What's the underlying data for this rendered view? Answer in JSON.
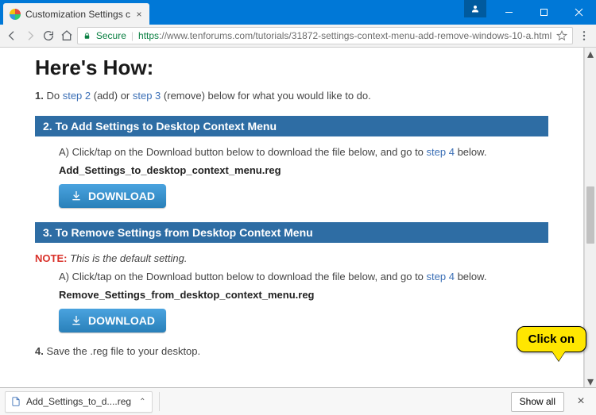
{
  "window": {
    "tab_title": "Customization Settings c",
    "user_icon": "user-icon"
  },
  "toolbar": {
    "secure_label": "Secure",
    "url_protocol": "https",
    "url_rest": "://www.tenforums.com/tutorials/31872-settings-context-menu-add-remove-windows-10-a.html"
  },
  "content": {
    "heading": "Here's How:",
    "step1": {
      "num": "1.",
      "pre": "Do ",
      "link_a": "step 2",
      "mid": " (add) or ",
      "link_b": "step 3",
      "post": " (remove) below for what you would like to do."
    },
    "section2": {
      "title": "2. To Add Settings to Desktop Context Menu",
      "lineA": {
        "prefix": "A) Click/tap on the Download button below to download the file below, and go to ",
        "link": "step 4",
        "suffix": " below."
      },
      "filename": "Add_Settings_to_desktop_context_menu.reg",
      "download": "DOWNLOAD"
    },
    "section3": {
      "title": "3. To Remove Settings from Desktop Context Menu",
      "note_label": "NOTE:",
      "note_text": "This is the default setting.",
      "lineA": {
        "prefix": "A) Click/tap on the Download button below to download the file below, and go to ",
        "link": "step 4",
        "suffix": " below."
      },
      "filename": "Remove_Settings_from_desktop_context_menu.reg",
      "download": "DOWNLOAD"
    },
    "step4": {
      "num": "4.",
      "text": " Save the .reg file to your desktop."
    }
  },
  "downloads": {
    "item": "Add_Settings_to_d....reg",
    "show_all": "Show all"
  },
  "callout": "Click on"
}
